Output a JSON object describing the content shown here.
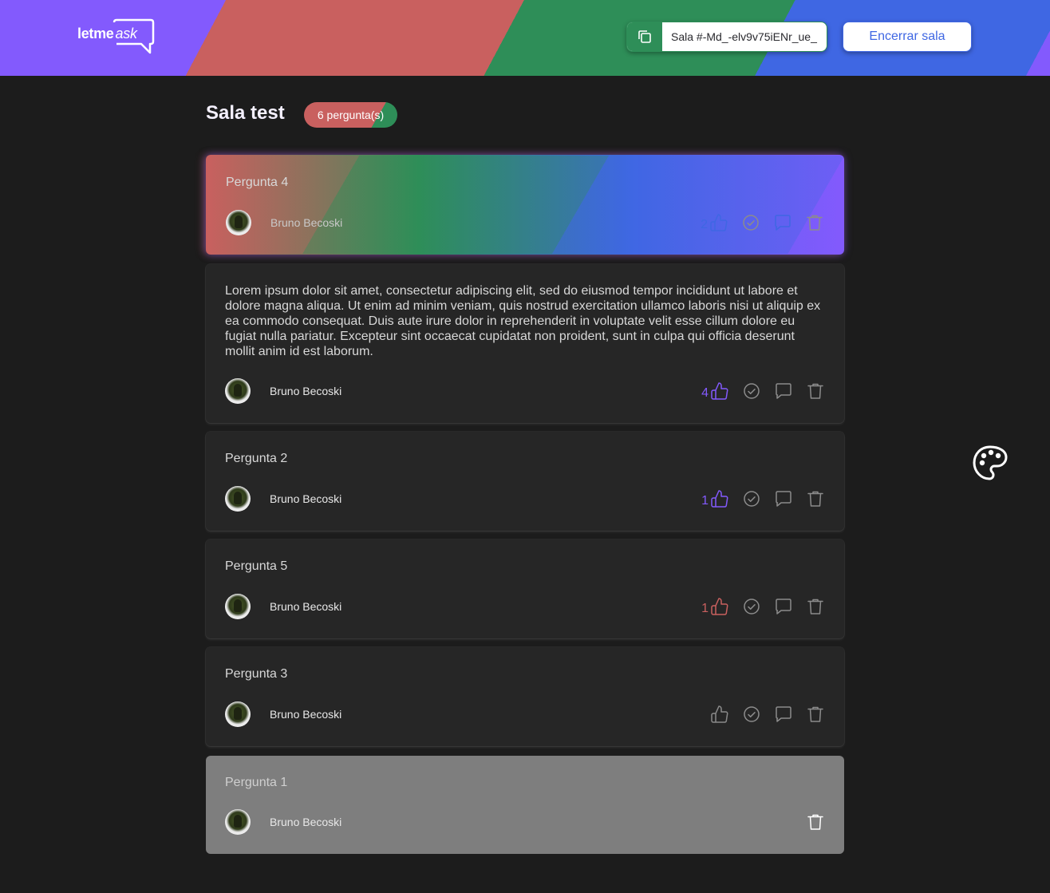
{
  "header": {
    "logo_main": "letme",
    "logo_accent": "ask",
    "room_code": "Sala #-Md_-elv9v75iENr_ue_",
    "close_room_label": "Encerrar sala"
  },
  "room": {
    "title": "Sala test",
    "question_count_label": "6 pergunta(s)"
  },
  "questions": [
    {
      "text": "Pergunta 4",
      "author": "Bruno Becoski",
      "likes": "2",
      "like_color": "#3f67e3",
      "state": "highlighted"
    },
    {
      "text": "Lorem ipsum dolor sit amet, consectetur adipiscing elit, sed do eiusmod tempor incididunt ut labore et dolore magna aliqua. Ut enim ad minim veniam, quis nostrud exercitation ullamco laboris nisi ut aliquip ex ea commodo consequat. Duis aute irure dolor in reprehenderit in voluptate velit esse cillum dolore eu fugiat nulla pariatur. Excepteur sint occaecat cupidatat non proident, sunt in culpa qui officia deserunt mollit anim id est laborum.",
      "author": "Bruno Becoski",
      "likes": "4",
      "like_color": "#835afd",
      "state": "normal"
    },
    {
      "text": "Pergunta 2",
      "author": "Bruno Becoski",
      "likes": "1",
      "like_color": "#835afd",
      "state": "normal"
    },
    {
      "text": "Pergunta 5",
      "author": "Bruno Becoski",
      "likes": "1",
      "like_color": "#c9605f",
      "state": "normal"
    },
    {
      "text": "Pergunta 3",
      "author": "Bruno Becoski",
      "likes": "",
      "like_color": "#8a8a8a",
      "state": "normal"
    },
    {
      "text": "Pergunta 1",
      "author": "Bruno Becoski",
      "likes": "",
      "like_color": "",
      "state": "answered"
    }
  ],
  "icons": {
    "copy": "copy-icon",
    "like": "thumbs-up-icon",
    "check": "check-circle-icon",
    "answer": "chat-bubble-icon",
    "delete": "trash-icon",
    "theme": "palette-icon"
  },
  "colors": {
    "purple": "#835afd",
    "red": "#c9605f",
    "green": "#2e8e58",
    "blue": "#3f67e3",
    "background": "#1c1c1c",
    "card": "#262626"
  }
}
